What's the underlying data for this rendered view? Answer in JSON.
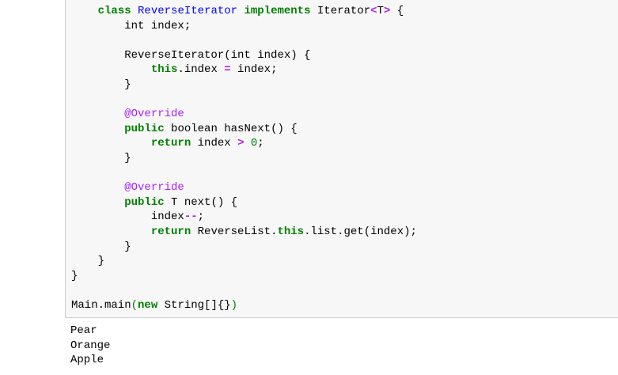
{
  "code_cell": {
    "lines": [
      [
        {
          "t": "    "
        },
        {
          "t": "class",
          "c": "kw"
        },
        {
          "t": " "
        },
        {
          "t": "ReverseIterator",
          "c": "cls"
        },
        {
          "t": " "
        },
        {
          "t": "implements",
          "c": "kw"
        },
        {
          "t": " Iterator"
        },
        {
          "t": "<",
          "c": "op"
        },
        {
          "t": "T"
        },
        {
          "t": ">",
          "c": "op"
        },
        {
          "t": " {"
        }
      ],
      [
        {
          "t": "        int index;"
        }
      ],
      [
        {
          "t": ""
        }
      ],
      [
        {
          "t": "        ReverseIterator(int index) {"
        }
      ],
      [
        {
          "t": "            "
        },
        {
          "t": "this",
          "c": "kw"
        },
        {
          "t": ".index "
        },
        {
          "t": "=",
          "c": "op"
        },
        {
          "t": " index;"
        }
      ],
      [
        {
          "t": "        }"
        }
      ],
      [
        {
          "t": ""
        }
      ],
      [
        {
          "t": "        "
        },
        {
          "t": "@Override",
          "c": "anno"
        }
      ],
      [
        {
          "t": "        "
        },
        {
          "t": "public",
          "c": "kw"
        },
        {
          "t": " boolean hasNext() {"
        }
      ],
      [
        {
          "t": "            "
        },
        {
          "t": "return",
          "c": "kw"
        },
        {
          "t": " index "
        },
        {
          "t": ">",
          "c": "op"
        },
        {
          "t": " "
        },
        {
          "t": "0",
          "c": "num"
        },
        {
          "t": ";"
        }
      ],
      [
        {
          "t": "        }"
        }
      ],
      [
        {
          "t": ""
        }
      ],
      [
        {
          "t": "        "
        },
        {
          "t": "@Override",
          "c": "anno"
        }
      ],
      [
        {
          "t": "        "
        },
        {
          "t": "public",
          "c": "kw"
        },
        {
          "t": " T next() {"
        }
      ],
      [
        {
          "t": "            index"
        },
        {
          "t": "--",
          "c": "op"
        },
        {
          "t": ";"
        }
      ],
      [
        {
          "t": "            "
        },
        {
          "t": "return",
          "c": "kw"
        },
        {
          "t": " ReverseList."
        },
        {
          "t": "this",
          "c": "kw"
        },
        {
          "t": ".list.get(index);"
        }
      ],
      [
        {
          "t": "        }"
        }
      ],
      [
        {
          "t": "    }"
        }
      ],
      [
        {
          "t": "}"
        }
      ],
      [
        {
          "t": ""
        }
      ],
      [
        {
          "t": "Main.main"
        },
        {
          "t": "(",
          "c": "paren"
        },
        {
          "t": "new",
          "c": "kw"
        },
        {
          "t": " String[]{}"
        },
        {
          "t": ")",
          "c": "paren"
        }
      ]
    ]
  },
  "output": {
    "lines": [
      "Pear",
      "Orange",
      "Apple"
    ]
  }
}
